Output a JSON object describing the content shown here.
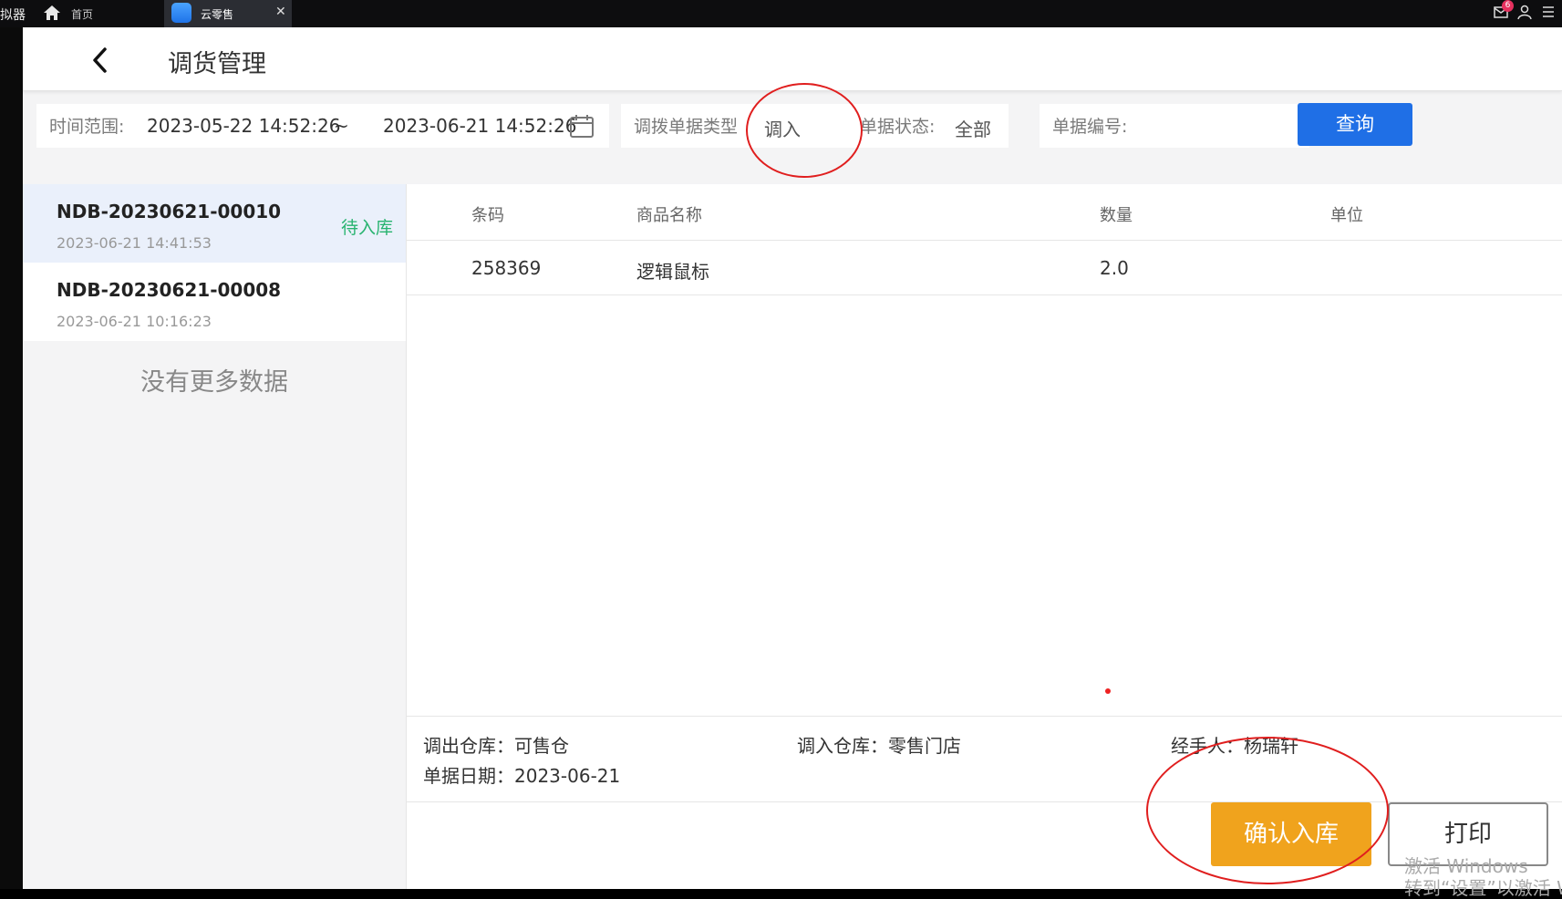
{
  "topbar": {
    "emulator_label": "拟器",
    "home_label": "首页",
    "tab_label": "云零售",
    "close_glyph": "✕",
    "notification_count": "6"
  },
  "header": {
    "title": "调货管理"
  },
  "filter": {
    "time_label": "时间范围:",
    "start_time": "2023-05-22 14:52:26",
    "tilde": "~",
    "end_time": "2023-06-21 14:52:26",
    "type_label": "调拨单据类型",
    "type_value": "调入",
    "status_label": "单据状态:",
    "status_value": "全部",
    "number_label": "单据编号:",
    "number_value": "",
    "query_label": "查询"
  },
  "list": {
    "items": [
      {
        "no": "NDB-20230621-00010",
        "date": "2023-06-21 14:41:53",
        "status": "待入库"
      },
      {
        "no": "NDB-20230621-00008",
        "date": "2023-06-21 10:16:23",
        "status": ""
      }
    ],
    "no_more": "没有更多数据"
  },
  "table": {
    "headers": [
      "条码",
      "商品名称",
      "数量",
      "单位"
    ],
    "rows": [
      {
        "barcode": "258369",
        "name": "逻辑鼠标",
        "qty": "2.0",
        "unit": ""
      }
    ]
  },
  "info": {
    "out_warehouse": "调出仓库：可售仓",
    "in_warehouse": "调入仓库：零售门店",
    "handler": "经手人：杨瑞轩",
    "doc_date": "单据日期：2023-06-21"
  },
  "actions": {
    "confirm_label": "确认入库",
    "print_label": "打印"
  },
  "watermark": {
    "line1": "激活 Windows",
    "line2": "转到“设置”以激活 Windo"
  },
  "colors": {
    "accent_blue": "#1f6fe6",
    "confirm_orange": "#f0a31d",
    "status_green": "#27b36f",
    "annotation_red": "#e01e1e"
  }
}
